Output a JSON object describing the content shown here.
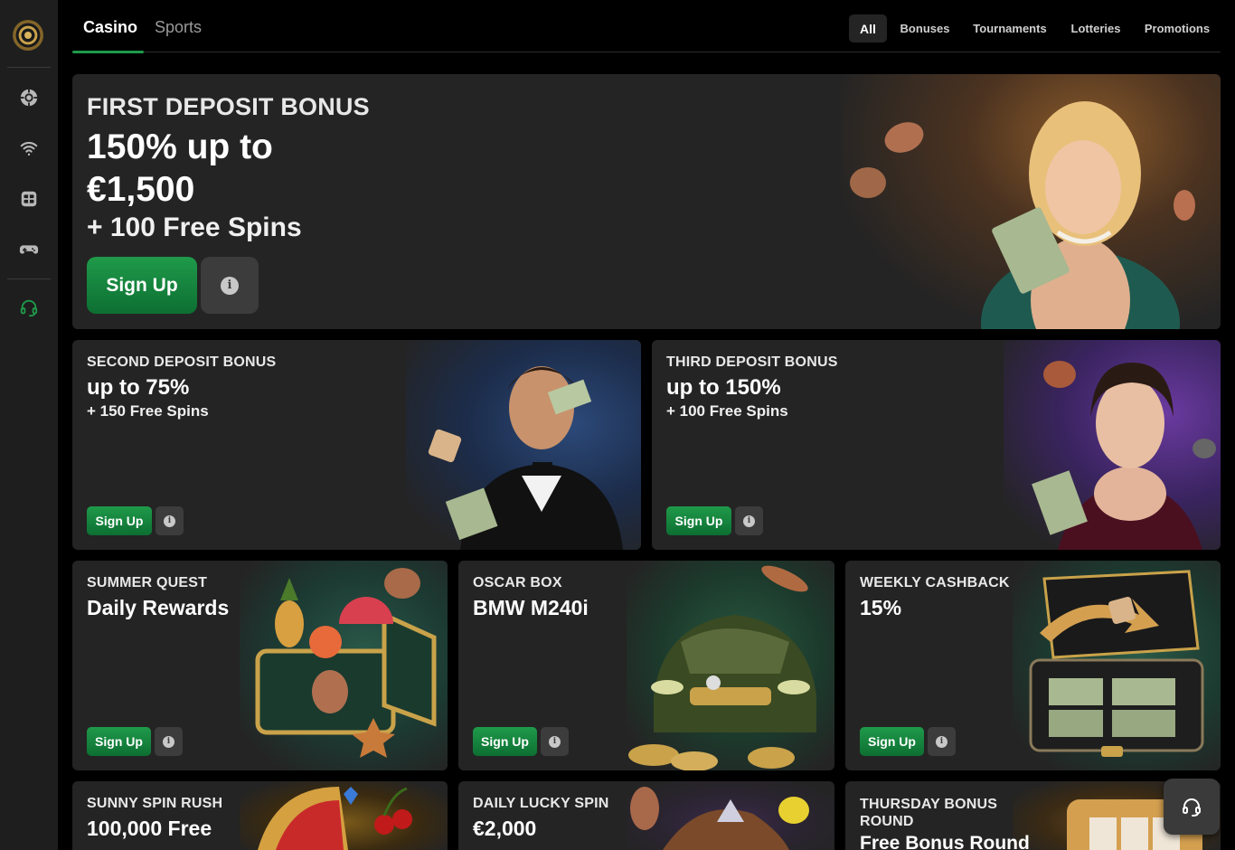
{
  "nav": {
    "tabs": [
      {
        "label": "Casino",
        "active": true
      },
      {
        "label": "Sports",
        "active": false
      }
    ],
    "filters": [
      {
        "label": "All",
        "active": true
      },
      {
        "label": "Bonuses",
        "active": false
      },
      {
        "label": "Tournaments",
        "active": false
      },
      {
        "label": "Lotteries",
        "active": false
      },
      {
        "label": "Promotions",
        "active": false
      }
    ],
    "accent_color": "#1e9a4a"
  },
  "sidebar": {
    "icons": [
      "logo-icon",
      "casino-chip-icon",
      "live-signal-icon",
      "slots-icon",
      "gamepad-icon",
      "support-headset-icon"
    ]
  },
  "promos": [
    {
      "eyebrow": "FIRST DEPOSIT BONUS",
      "headline": "150% up to €1,500",
      "sub": "+ 100 Free Spins",
      "cta": "Sign Up"
    },
    {
      "eyebrow": "SECOND DEPOSIT BONUS",
      "headline": "up to 75%",
      "sub": "+ 150 Free Spins",
      "cta": "Sign Up"
    },
    {
      "eyebrow": "THIRD DEPOSIT BONUS",
      "headline": "up to 150%",
      "sub": "+ 100 Free Spins",
      "cta": "Sign Up"
    },
    {
      "eyebrow": "SUMMER QUEST",
      "headline": "Daily Rewards",
      "cta": "Sign Up"
    },
    {
      "eyebrow": "OSCAR BOX",
      "headline": "BMW M240i",
      "cta": "Sign Up"
    },
    {
      "eyebrow": "WEEKLY CASHBACK",
      "headline": "15%",
      "cta": "Sign Up"
    },
    {
      "eyebrow": "SUNNY SPIN RUSH",
      "headline": "100,000 Free"
    },
    {
      "eyebrow": "DAILY LUCKY SPIN",
      "headline": "€2,000"
    },
    {
      "eyebrow": "THURSDAY BONUS ROUND",
      "headline": "Free Bonus Round"
    }
  ],
  "info_glyph": "i",
  "support_fab": {
    "icon": "headset-icon"
  }
}
